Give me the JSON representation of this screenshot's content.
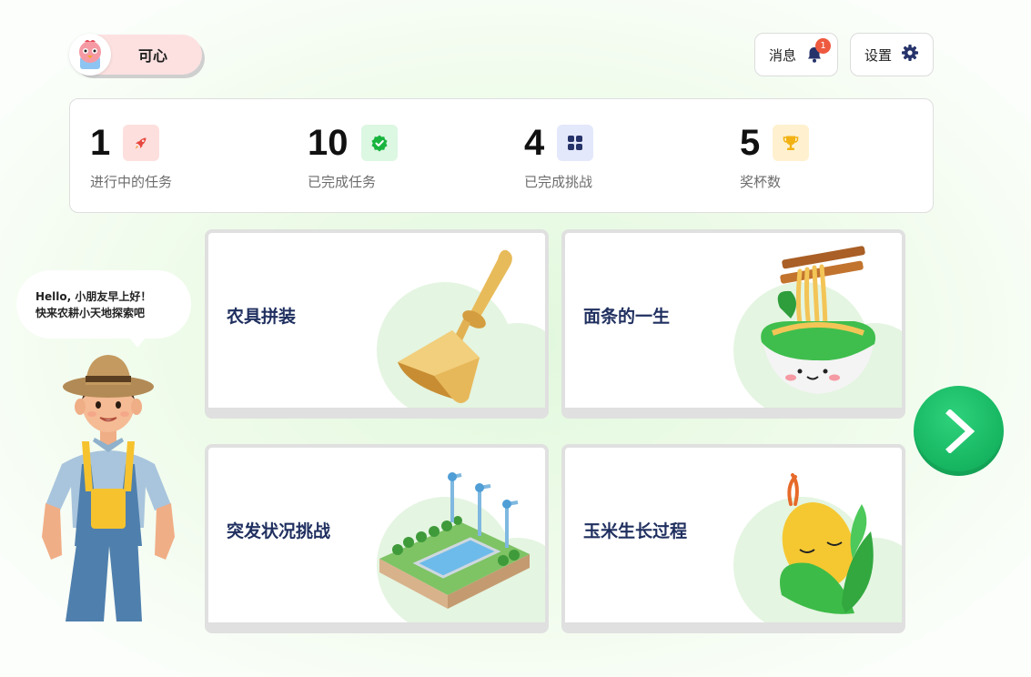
{
  "user": {
    "name": "可心",
    "avatar_icon": "chick-avatar-icon"
  },
  "header": {
    "messages_label": "消息",
    "messages_badge": "1",
    "settings_label": "设置"
  },
  "stats": [
    {
      "value": "1",
      "label": "进行中的任务",
      "icon": "rocket-icon",
      "color": "#fde0de"
    },
    {
      "value": "10",
      "label": "已完成任务",
      "icon": "check-badge-icon",
      "color": "#dcf7e2"
    },
    {
      "value": "4",
      "label": "已完成挑战",
      "icon": "grid-icon",
      "color": "#e4e8fb"
    },
    {
      "value": "5",
      "label": "奖杯数",
      "icon": "trophy-icon",
      "color": "#fff1cf"
    }
  ],
  "guide": {
    "bubble_line1": "Hello, 小朋友早上好！",
    "bubble_line2": "快来农耕小天地探索吧"
  },
  "cards": [
    {
      "title": "农具拼装",
      "icon": "shovel-illustration"
    },
    {
      "title": "面条的一生",
      "icon": "noodle-bowl-illustration"
    },
    {
      "title": "突发状况挑战",
      "icon": "irrigation-field-illustration"
    },
    {
      "title": "玉米生长过程",
      "icon": "corn-illustration"
    }
  ],
  "colors": {
    "accent_green": "#18b863",
    "title_navy": "#1f2f5f",
    "badge_red": "#ee5a3f"
  }
}
